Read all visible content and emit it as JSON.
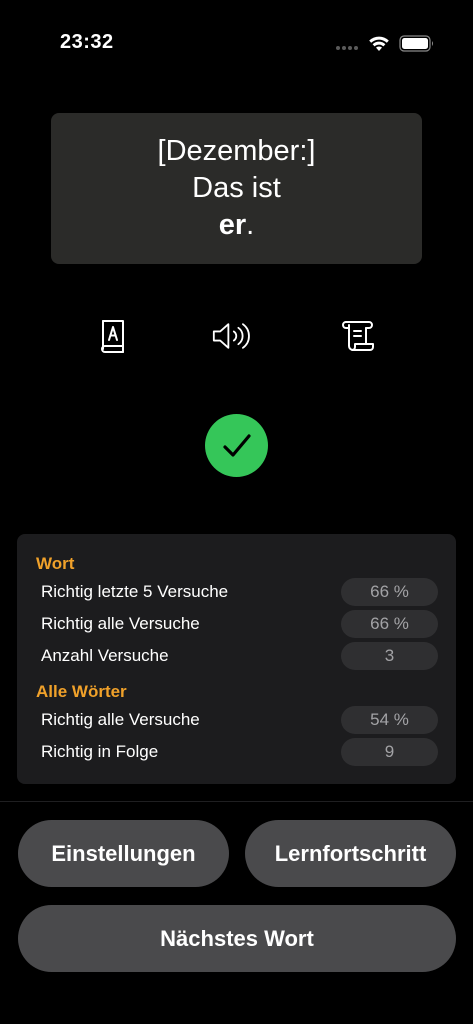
{
  "status_bar": {
    "time": "23:32"
  },
  "word_card": {
    "line1": "[Dezember:]",
    "line2": "Das ist",
    "answer": "er",
    "punctuation": "."
  },
  "actions": {
    "icons": [
      "dictionary-icon",
      "speaker-icon",
      "scroll-icon"
    ]
  },
  "result": {
    "icon": "checkmark-icon",
    "color": "#35c659"
  },
  "stats": {
    "word_title": "Wort",
    "word_rows": [
      {
        "label": "Richtig letzte 5 Versuche",
        "value": "66 %"
      },
      {
        "label": "Richtig alle Versuche",
        "value": "66 %"
      },
      {
        "label": "Anzahl Versuche",
        "value": "3"
      }
    ],
    "all_title": "Alle Wörter",
    "all_rows": [
      {
        "label": "Richtig alle Versuche",
        "value": "54 %"
      },
      {
        "label": "Richtig in Folge",
        "value": "9"
      }
    ]
  },
  "buttons": {
    "settings": "Einstellungen",
    "progress": "Lernfortschritt",
    "next": "Nächstes Wort"
  },
  "colors": {
    "accent": "#f0a12a",
    "background": "#000000",
    "card": "#2b2b29",
    "panel": "#1c1c1e",
    "button": "#4a4a4c"
  }
}
